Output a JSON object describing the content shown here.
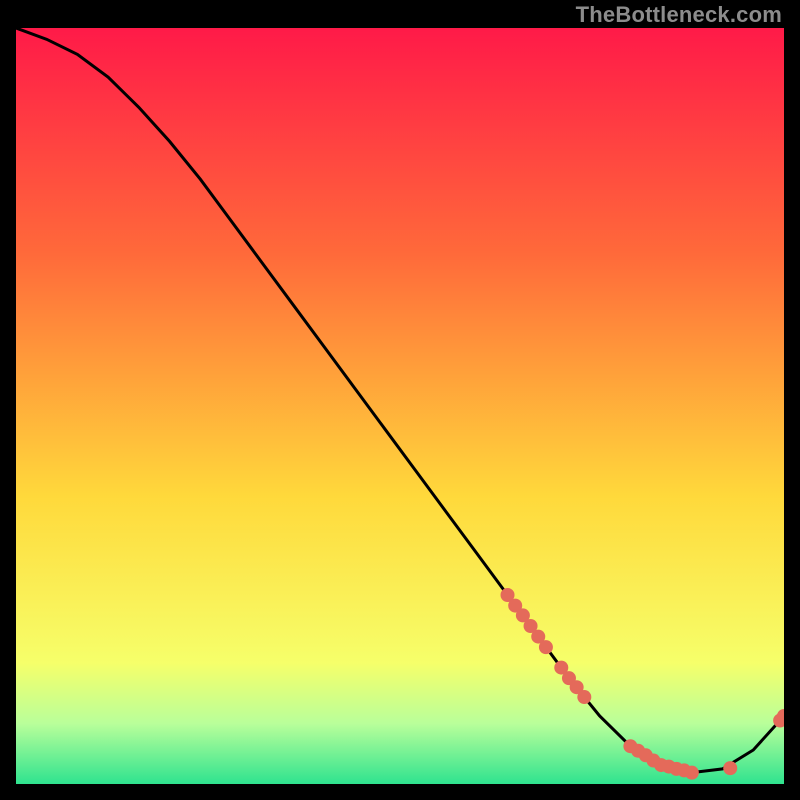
{
  "watermark": "TheBottleneck.com",
  "colors": {
    "gradient_top": "#ff1a48",
    "gradient_mid1": "#ff6a3a",
    "gradient_mid2": "#ffd93b",
    "gradient_mid3": "#f6ff6a",
    "gradient_green1": "#b9ff9a",
    "gradient_green2": "#2fe38f",
    "curve": "#000000",
    "marker": "#e46a5a",
    "frame": "#000000"
  },
  "chart_data": {
    "type": "line",
    "title": "",
    "xlabel": "",
    "ylabel": "",
    "xlim": [
      0,
      100
    ],
    "ylim": [
      0,
      100
    ],
    "curve": {
      "x": [
        0,
        4,
        8,
        12,
        16,
        20,
        24,
        28,
        32,
        36,
        40,
        44,
        48,
        52,
        56,
        60,
        64,
        68,
        72,
        76,
        80,
        84,
        88,
        92,
        96,
        100
      ],
      "y": [
        100,
        98.5,
        96.5,
        93.5,
        89.5,
        85,
        80,
        74.5,
        69,
        63.5,
        58,
        52.5,
        47,
        41.5,
        36,
        30.5,
        25,
        19.5,
        14,
        9,
        5,
        2.5,
        1.5,
        2,
        4.5,
        9
      ]
    },
    "series": [
      {
        "name": "markers",
        "x": [
          64,
          65,
          66,
          67,
          68,
          69,
          71,
          72,
          73,
          74,
          80,
          81,
          82,
          83,
          84,
          85,
          86,
          87,
          88,
          93,
          99.5,
          100
        ],
        "y": [
          25.0,
          23.6,
          22.3,
          20.9,
          19.5,
          18.1,
          15.4,
          14.0,
          12.8,
          11.5,
          5.0,
          4.4,
          3.8,
          3.1,
          2.5,
          2.3,
          2.0,
          1.8,
          1.5,
          2.1,
          8.4,
          9.0
        ]
      }
    ]
  }
}
